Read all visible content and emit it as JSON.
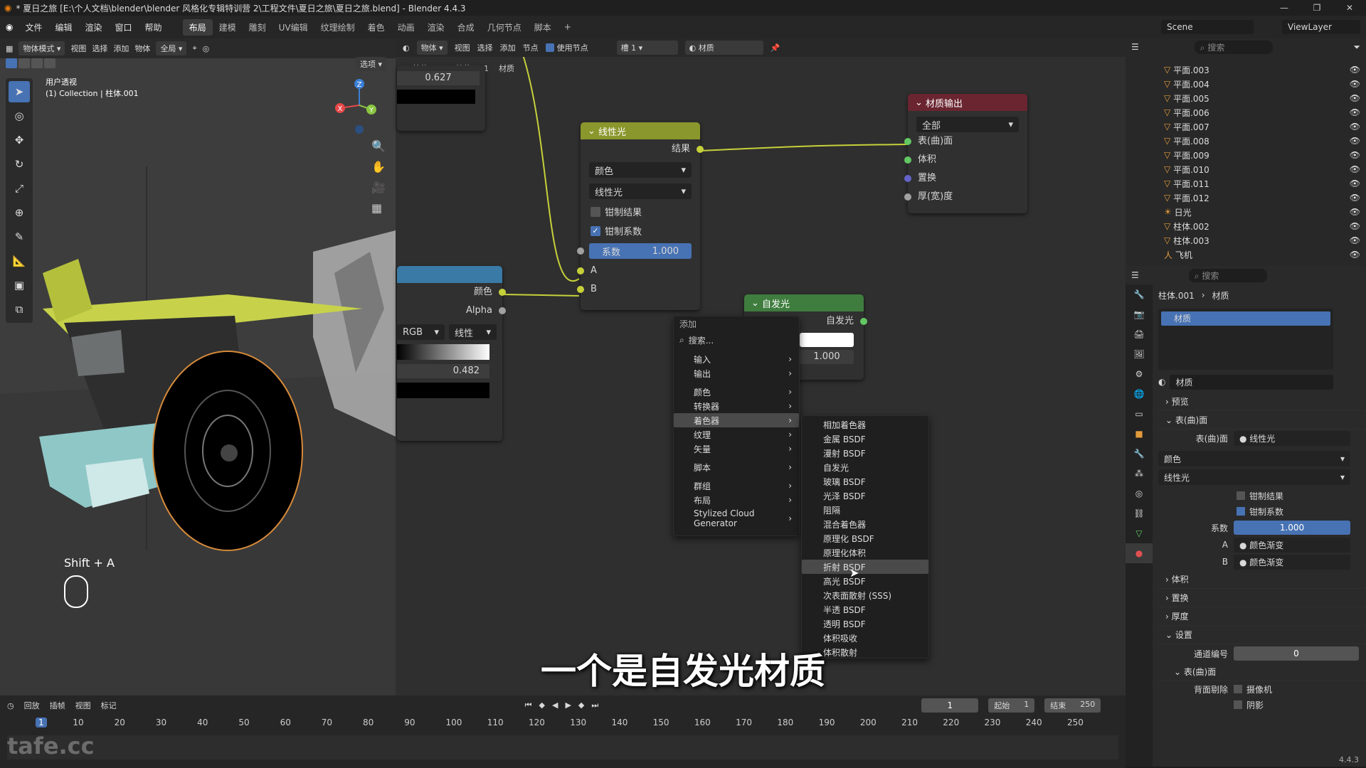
{
  "titlebar": {
    "title": "* 夏日之旅 [E:\\个人文档\\blender\\blender 风格化专辑特训营 2\\工程文件\\夏日之旅\\夏日之旅.blend] - Blender 4.4.3"
  },
  "menubar": {
    "items": [
      "文件",
      "编辑",
      "渲染",
      "窗口",
      "帮助"
    ],
    "workspaces": [
      "布局",
      "建模",
      "雕刻",
      "UV编辑",
      "纹理绘制",
      "着色",
      "动画",
      "渲染",
      "合成",
      "几何节点",
      "脚本"
    ],
    "active_workspace": "布局",
    "scene": "Scene",
    "viewlayer": "ViewLayer"
  },
  "viewport": {
    "mode": "物体模式",
    "menus": [
      "视图",
      "选择",
      "添加",
      "物体"
    ],
    "transform": "全局",
    "options": "选项",
    "view_name": "用户透视",
    "collection_info": "(1) Collection | 柱体.001",
    "shortcut_text": "Shift + A",
    "gizmo_axes": [
      "X",
      "Y",
      "Z"
    ]
  },
  "node_editor": {
    "header": {
      "object_type": "物体",
      "menus": [
        "视图",
        "选择",
        "添加",
        "节点"
      ],
      "use_nodes_label": "使用节点",
      "slot": "槽 1",
      "material": "材质"
    },
    "breadcrumb": [
      "柱体.001",
      "柱体.001",
      "材质"
    ],
    "top_left_value": "0.627",
    "mix_node": {
      "title": "线性光",
      "output": "结果",
      "data_type": "颜色",
      "blend_mode": "线性光",
      "clamp_result": "钳制结果",
      "clamp_factor": "钳制系数",
      "factor_label": "系数",
      "factor_value": "1.000",
      "input_a": "A",
      "input_b": "B"
    },
    "ramp_node": {
      "out_color": "颜色",
      "out_alpha": "Alpha",
      "color_mode": "RGB",
      "interp": "线性",
      "pos_value": "0.482"
    },
    "output_node": {
      "title": "材质输出",
      "target": "全部",
      "inputs": [
        "表(曲)面",
        "体积",
        "置换",
        "厚(宽)度"
      ]
    },
    "emission_node": {
      "title": "自发光",
      "output": "自发光",
      "strength": "1.000"
    }
  },
  "add_menu": {
    "title": "添加",
    "search": "搜索...",
    "items": [
      "输入",
      "输出",
      "颜色",
      "转换器",
      "着色器",
      "纹理",
      "矢量",
      "脚本",
      "群组",
      "布局",
      "Stylized Cloud Generator"
    ],
    "highlighted": "着色器",
    "submenu": [
      "相加着色器",
      "金属 BSDF",
      "漫射 BSDF",
      "自发光",
      "玻璃 BSDF",
      "光泽 BSDF",
      "阻隔",
      "混合着色器",
      "原理化 BSDF",
      "原理化体积",
      "折射 BSDF",
      "高光 BSDF",
      "次表面散射 (SSS)",
      "半透 BSDF",
      "透明 BSDF",
      "体积吸收",
      "体积散射"
    ],
    "sub_highlighted": "折射 BSDF"
  },
  "outliner": {
    "search": "搜索",
    "items": [
      "平面.003",
      "平面.004",
      "平面.005",
      "平面.006",
      "平面.007",
      "平面.008",
      "平面.009",
      "平面.010",
      "平面.011",
      "平面.012",
      "日光",
      "柱体.002",
      "柱体.003",
      "飞机"
    ]
  },
  "properties": {
    "search": "搜索",
    "breadcrumb": [
      "柱体.001",
      "材质"
    ],
    "slot_name": "材质",
    "material_name": "材质",
    "sections": {
      "preview": "预览",
      "surface": "表(曲)面",
      "volume": "体积",
      "displacement": "置换",
      "thickness": "厚度",
      "settings": "设置"
    },
    "surface_label": "表(曲)面",
    "surface_value": "线性光",
    "data_type": "颜色",
    "blend_mode": "线性光",
    "clamp_result": "钳制结果",
    "clamp_factor": "钳制系数",
    "factor_label": "系数",
    "factor_value": "1.000",
    "a_label": "A",
    "a_value": "颜色渐变",
    "b_label": "B",
    "b_value": "颜色渐变",
    "pass_index_label": "通道编号",
    "pass_index": "0",
    "sub_surface": "表(曲)面",
    "backface": "背面剔除",
    "camera": "摄像机",
    "shadow": "阴影"
  },
  "timeline": {
    "menus": [
      "回放",
      "插帧",
      "视图",
      "标记"
    ],
    "current_frame": "1",
    "start_label": "起始",
    "start": "1",
    "end_label": "结束",
    "end": "250",
    "ticks": [
      "1",
      "10",
      "20",
      "30",
      "40",
      "50",
      "60",
      "70",
      "80",
      "90",
      "100",
      "110",
      "120",
      "130",
      "140",
      "150",
      "160",
      "170",
      "180",
      "190",
      "200",
      "210",
      "220",
      "230",
      "240",
      "250"
    ]
  },
  "watermark": "tafe.cc",
  "version": "4.4.3",
  "subtitle": "一个是自发光材质"
}
